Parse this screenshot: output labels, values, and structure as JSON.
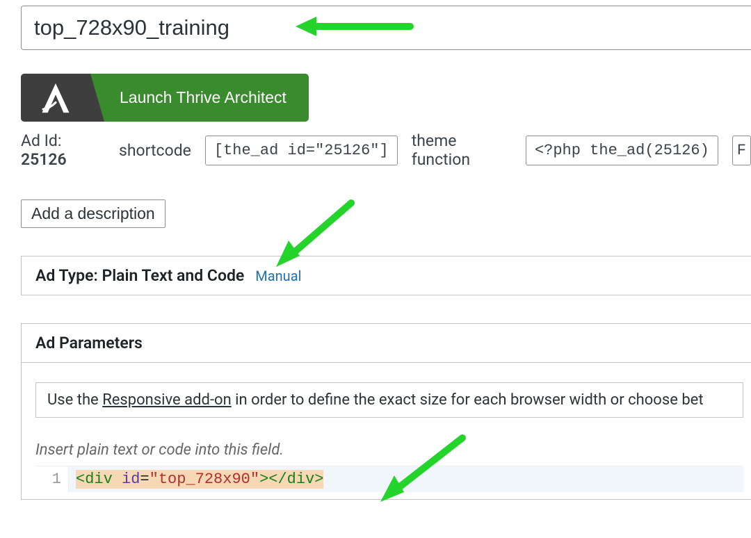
{
  "title_field": {
    "value": "top_728x90_training"
  },
  "thrive_button": {
    "label": "Launch Thrive Architect"
  },
  "meta": {
    "adid_label": "Ad Id:",
    "adid_value": "25126",
    "shortcode_label": "shortcode",
    "shortcode_code": "[the_ad id=\"25126\"]",
    "theme_fn_label": "theme function",
    "theme_fn_code": "<?php the_ad(25126)",
    "trailing": "F"
  },
  "description_button": "Add a description",
  "adtype_panel": {
    "title": "Ad Type: Plain Text and Code",
    "manual_link": "Manual"
  },
  "params_panel": {
    "title": "Ad Parameters",
    "notice_pre": "Use the ",
    "notice_link": "Responsive add-on",
    "notice_post": " in order to define the exact size for each browser width or choose bet",
    "hint": "Insert plain text or code into this field.",
    "editor": {
      "gutter": "1",
      "code_tokens": {
        "t1": "<div",
        "sp1": " ",
        "t2": "id",
        "eq": "=",
        "t3": "\"top_728x90\"",
        "t4": "></div>"
      }
    }
  }
}
